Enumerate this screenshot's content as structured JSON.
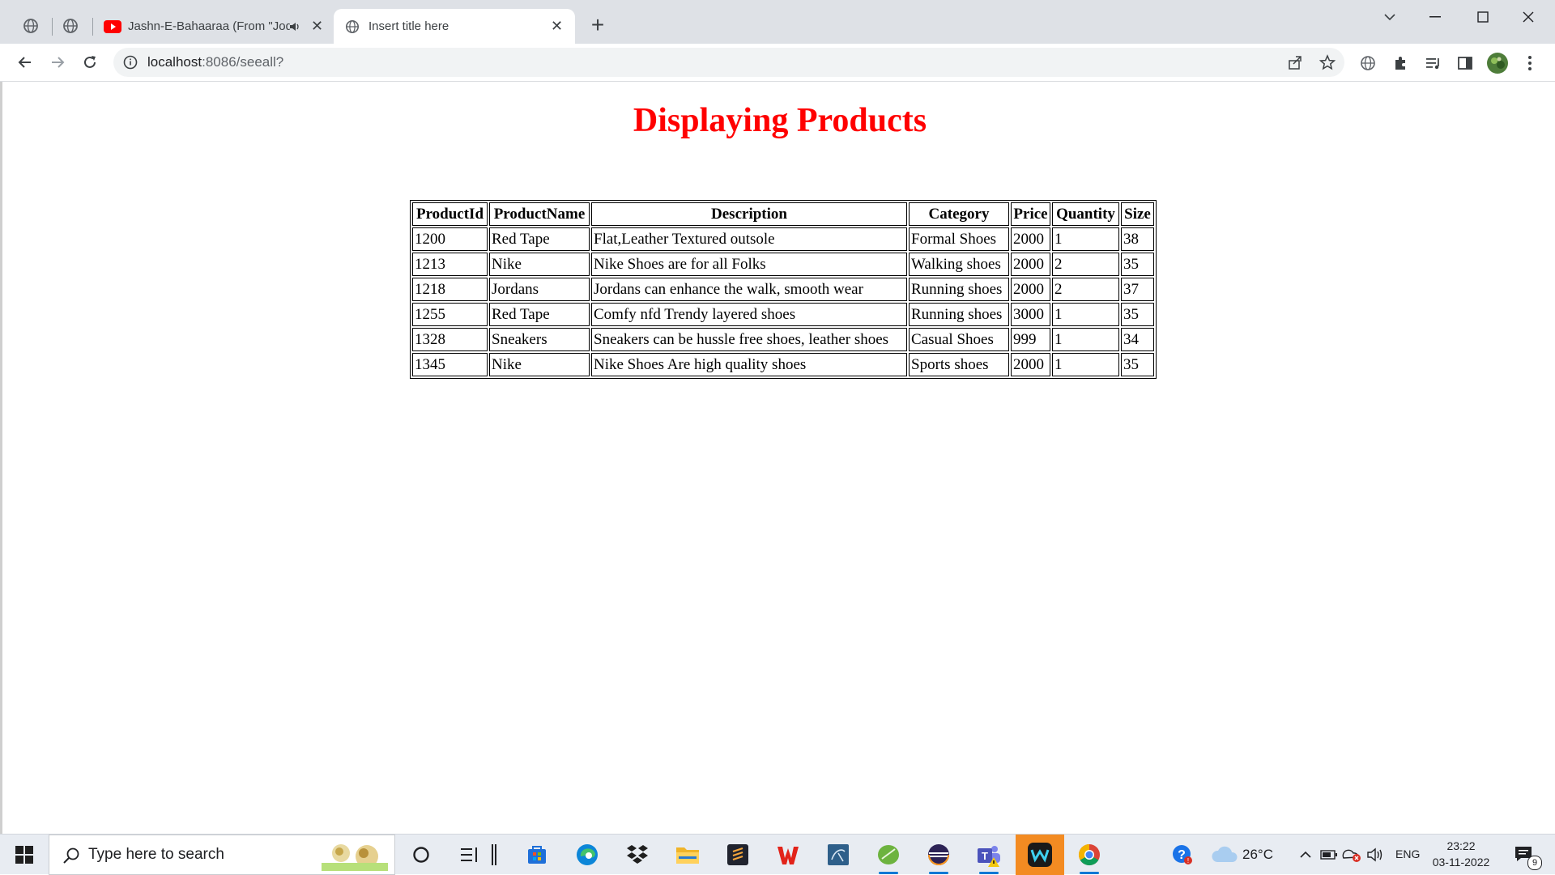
{
  "browser": {
    "tabs": [
      {
        "title": "Jashn-E-Bahaaraa (From \"Jodhaa Akbar\")",
        "active": false,
        "audio": true
      },
      {
        "title": "Insert title here",
        "active": true,
        "audio": false
      }
    ],
    "address": {
      "host": "localhost",
      "rest": ":8086/seeall?"
    }
  },
  "page": {
    "heading": "Displaying Products",
    "table": {
      "headers": [
        "ProductId",
        "ProductName",
        "Description",
        "Category",
        "Price",
        "Quantity",
        "Size"
      ],
      "rows": [
        [
          "1200",
          "Red Tape",
          "Flat,Leather Textured outsole",
          "Formal Shoes",
          "2000",
          "1",
          "38"
        ],
        [
          "1213",
          "Nike",
          "Nike Shoes are for all Folks",
          "Walking shoes",
          "2000",
          "2",
          "35"
        ],
        [
          "1218",
          "Jordans",
          "Jordans can enhance the walk, smooth wear",
          "Running shoes",
          "2000",
          "2",
          "37"
        ],
        [
          "1255",
          "Red Tape",
          "Comfy nfd Trendy layered shoes",
          "Running shoes",
          "3000",
          "1",
          "35"
        ],
        [
          "1328",
          "Sneakers",
          "Sneakers can be hussle free shoes, leather shoes",
          "Casual Shoes",
          "999",
          "1",
          "34"
        ],
        [
          "1345",
          "Nike",
          "Nike Shoes Are high quality shoes",
          "Sports shoes",
          "2000",
          "1",
          "35"
        ]
      ]
    }
  },
  "taskbar": {
    "search_placeholder": "Type here to search",
    "weather": "26°C",
    "language": "ENG",
    "time": "23:22",
    "date": "03-11-2022",
    "notification_count": "9"
  },
  "colors": {
    "heading": "#ff0000",
    "youtube": "#ff0000",
    "accent": "#0078d4"
  }
}
